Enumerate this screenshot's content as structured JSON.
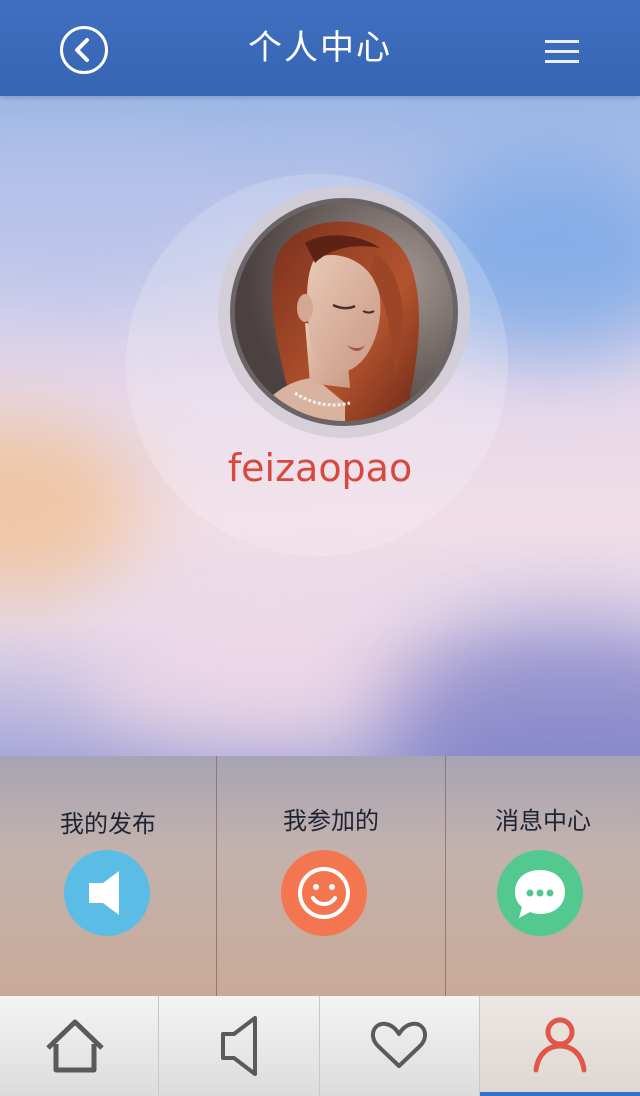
{
  "header": {
    "title": "个人中心",
    "back_icon": "chevron-left-circle-icon",
    "menu_icon": "hamburger-menu-icon"
  },
  "profile": {
    "username": "feizaopao",
    "avatar": "profile-photo"
  },
  "actions": [
    {
      "label": "我的发布",
      "icon": "speaker-icon",
      "color": "#5bbde6"
    },
    {
      "label": "我参加的",
      "icon": "smiley-icon",
      "color": "#f47650"
    },
    {
      "label": "消息中心",
      "icon": "chat-bubble-icon",
      "color": "#53c990"
    }
  ],
  "tabbar": {
    "items": [
      {
        "icon": "home-icon",
        "active": false
      },
      {
        "icon": "speaker-icon",
        "active": false
      },
      {
        "icon": "heart-icon",
        "active": false
      },
      {
        "icon": "user-icon",
        "active": true
      }
    ],
    "active_color": "#e0574a",
    "indicator_color": "#3370cc"
  }
}
